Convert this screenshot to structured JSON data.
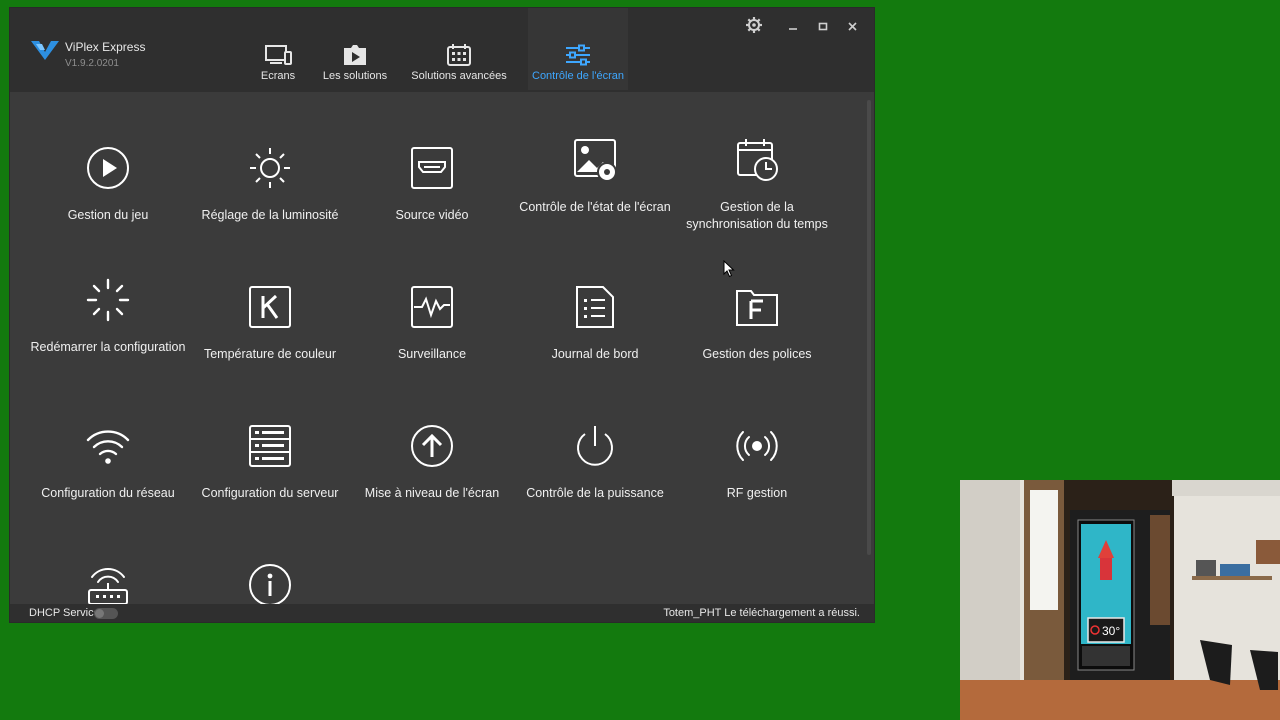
{
  "app": {
    "name": "ViPlex Express",
    "version": "V1.9.2.0201"
  },
  "tabs": [
    {
      "label": "Ecrans",
      "icon": "monitor-icon"
    },
    {
      "label": "Les solutions",
      "icon": "play-folder-icon"
    },
    {
      "label": "Solutions avancées",
      "icon": "calendar-icon"
    },
    {
      "label": "Contrôle de l'écran",
      "icon": "sliders-icon",
      "active": true
    }
  ],
  "tiles": [
    {
      "label": "Gestion du jeu",
      "icon": "play-circle-icon"
    },
    {
      "label": "Réglage de la luminosité",
      "icon": "brightness-icon"
    },
    {
      "label": "Source vidéo",
      "icon": "hdmi-icon"
    },
    {
      "label": "Contrôle de l'état de l'écran",
      "icon": "screen-status-icon"
    },
    {
      "label": "Gestion de la synchronisation du temps",
      "icon": "calendar-clock-icon"
    },
    {
      "label": "Redémarrer la configuration",
      "icon": "loading-icon"
    },
    {
      "label": "Température de couleur",
      "icon": "k-icon"
    },
    {
      "label": "Surveillance",
      "icon": "pulse-icon"
    },
    {
      "label": "Journal de bord",
      "icon": "log-icon"
    },
    {
      "label": "Gestion des polices",
      "icon": "font-folder-icon"
    },
    {
      "label": "Configuration du réseau",
      "icon": "wifi-icon"
    },
    {
      "label": "Configuration du serveur",
      "icon": "server-icon"
    },
    {
      "label": "Mise à niveau de l'écran",
      "icon": "upgrade-icon"
    },
    {
      "label": "Contrôle de la puissance",
      "icon": "power-icon"
    },
    {
      "label": "RF gestion",
      "icon": "rf-icon"
    },
    {
      "label": "",
      "icon": "router-icon"
    },
    {
      "label": "",
      "icon": "info-icon"
    }
  ],
  "status": {
    "dhcp_label": "DHCP Service",
    "message": "Totem_PHT Le téléchargement a réussi."
  },
  "webcam": {
    "temperature": "30°"
  },
  "colors": {
    "accent": "#3ea7ff",
    "background": "#137a0e",
    "window": "#3b3b3b"
  }
}
